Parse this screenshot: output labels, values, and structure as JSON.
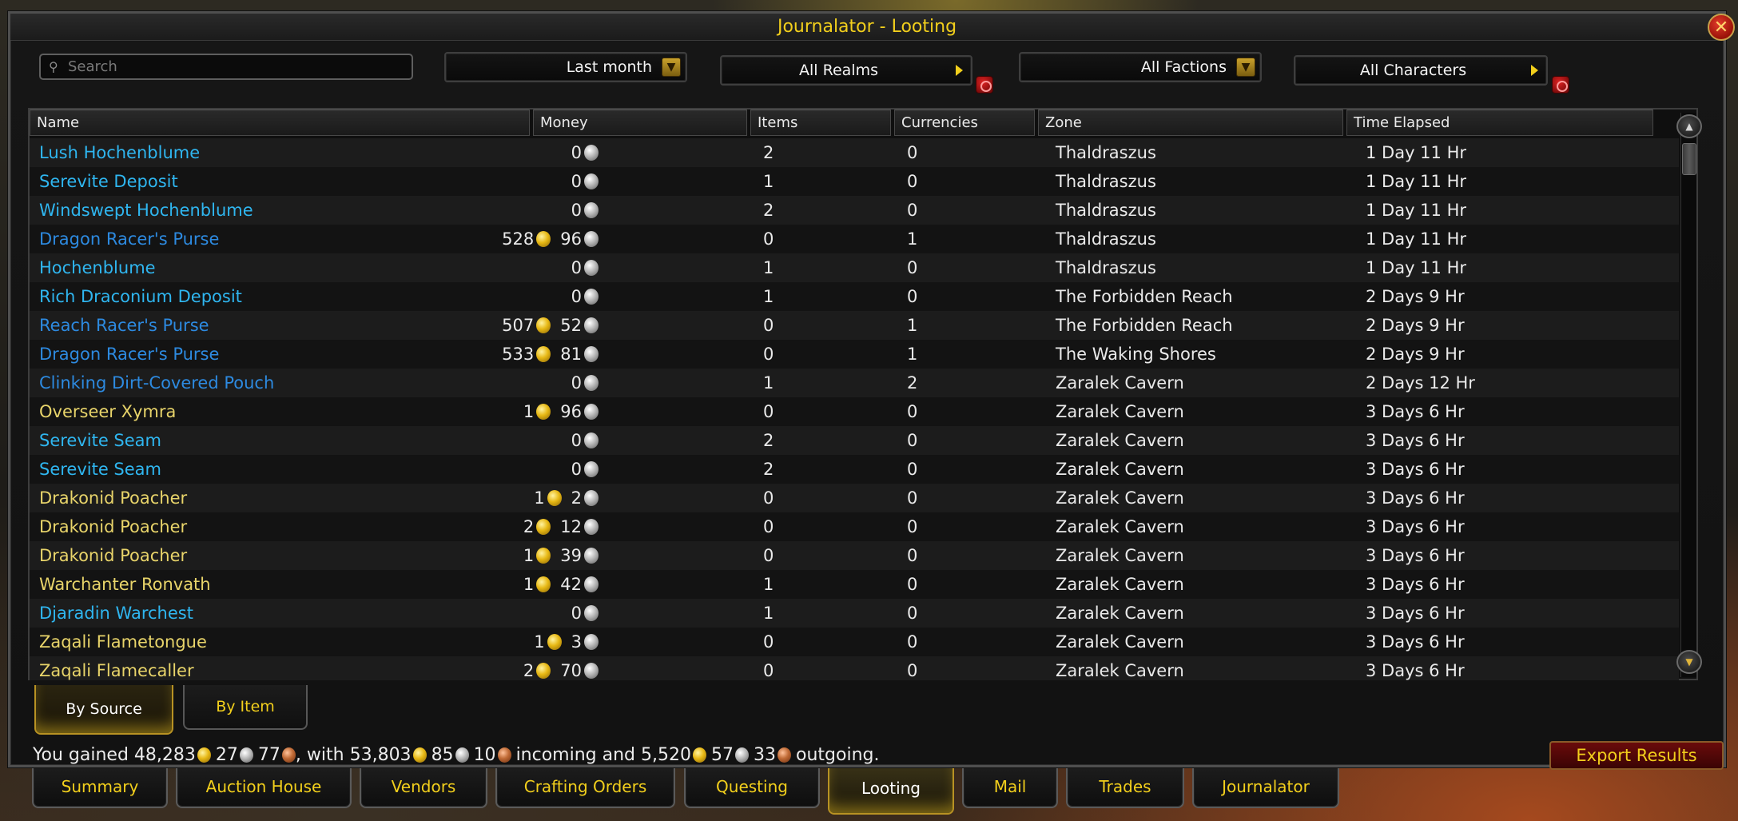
{
  "window": {
    "title": "Journalator - Looting",
    "close_icon": "close-icon"
  },
  "filters": {
    "search_placeholder": "Search",
    "time_range": "Last month",
    "realms": "All Realms",
    "factions": "All Factions",
    "characters": "All Characters"
  },
  "columns": [
    "Name",
    "Money",
    "Items",
    "Currencies",
    "Zone",
    "Time Elapsed"
  ],
  "colors": {
    "gold_text": "#f2cf1c",
    "name_gold": "#e8d46a",
    "name_cyan": "#2fb6f0",
    "name_blue": "#2d8ae0",
    "export_bg": "#6a0b0b"
  },
  "rows": [
    {
      "name": "Lush Hochenblume",
      "color": "cyan",
      "gold": null,
      "silver": "0",
      "items": "2",
      "currencies": "0",
      "zone": "Thaldraszus",
      "time": "1 Day 11 Hr"
    },
    {
      "name": "Serevite Deposit",
      "color": "cyan",
      "gold": null,
      "silver": "0",
      "items": "1",
      "currencies": "0",
      "zone": "Thaldraszus",
      "time": "1 Day 11 Hr"
    },
    {
      "name": "Windswept Hochenblume",
      "color": "cyan",
      "gold": null,
      "silver": "0",
      "items": "2",
      "currencies": "0",
      "zone": "Thaldraszus",
      "time": "1 Day 11 Hr"
    },
    {
      "name": "Dragon Racer's Purse",
      "color": "blue",
      "gold": "528",
      "silver": "96",
      "items": "0",
      "currencies": "1",
      "zone": "Thaldraszus",
      "time": "1 Day 11 Hr"
    },
    {
      "name": "Hochenblume",
      "color": "cyan",
      "gold": null,
      "silver": "0",
      "items": "1",
      "currencies": "0",
      "zone": "Thaldraszus",
      "time": "1 Day 11 Hr"
    },
    {
      "name": "Rich Draconium Deposit",
      "color": "cyan",
      "gold": null,
      "silver": "0",
      "items": "1",
      "currencies": "0",
      "zone": "The Forbidden Reach",
      "time": "2 Days 9 Hr"
    },
    {
      "name": "Reach Racer's Purse",
      "color": "blue",
      "gold": "507",
      "silver": "52",
      "items": "0",
      "currencies": "1",
      "zone": "The Forbidden Reach",
      "time": "2 Days 9 Hr"
    },
    {
      "name": "Dragon Racer's Purse",
      "color": "blue",
      "gold": "533",
      "silver": "81",
      "items": "0",
      "currencies": "1",
      "zone": "The Waking Shores",
      "time": "2 Days 9 Hr"
    },
    {
      "name": "Clinking Dirt-Covered Pouch",
      "color": "blue",
      "gold": null,
      "silver": "0",
      "items": "1",
      "currencies": "2",
      "zone": "Zaralek Cavern",
      "time": "2 Days 12 Hr"
    },
    {
      "name": "Overseer Xymra",
      "color": "gold",
      "gold": "1",
      "silver": "96",
      "items": "0",
      "currencies": "0",
      "zone": "Zaralek Cavern",
      "time": "3 Days 6 Hr"
    },
    {
      "name": "Serevite Seam",
      "color": "cyan",
      "gold": null,
      "silver": "0",
      "items": "2",
      "currencies": "0",
      "zone": "Zaralek Cavern",
      "time": "3 Days 6 Hr"
    },
    {
      "name": "Serevite Seam",
      "color": "cyan",
      "gold": null,
      "silver": "0",
      "items": "2",
      "currencies": "0",
      "zone": "Zaralek Cavern",
      "time": "3 Days 6 Hr"
    },
    {
      "name": "Drakonid Poacher",
      "color": "gold",
      "gold": "1",
      "silver": "2",
      "items": "0",
      "currencies": "0",
      "zone": "Zaralek Cavern",
      "time": "3 Days 6 Hr"
    },
    {
      "name": "Drakonid Poacher",
      "color": "gold",
      "gold": "2",
      "silver": "12",
      "items": "0",
      "currencies": "0",
      "zone": "Zaralek Cavern",
      "time": "3 Days 6 Hr"
    },
    {
      "name": "Drakonid Poacher",
      "color": "gold",
      "gold": "1",
      "silver": "39",
      "items": "0",
      "currencies": "0",
      "zone": "Zaralek Cavern",
      "time": "3 Days 6 Hr"
    },
    {
      "name": "Warchanter Ronvath",
      "color": "gold",
      "gold": "1",
      "silver": "42",
      "items": "1",
      "currencies": "0",
      "zone": "Zaralek Cavern",
      "time": "3 Days 6 Hr"
    },
    {
      "name": "Djaradin Warchest",
      "color": "cyan",
      "gold": null,
      "silver": "0",
      "items": "1",
      "currencies": "0",
      "zone": "Zaralek Cavern",
      "time": "3 Days 6 Hr"
    },
    {
      "name": "Zaqali Flametongue",
      "color": "gold",
      "gold": "1",
      "silver": "3",
      "items": "0",
      "currencies": "0",
      "zone": "Zaralek Cavern",
      "time": "3 Days 6 Hr"
    },
    {
      "name": "Zaqali Flamecaller",
      "color": "gold",
      "gold": "2",
      "silver": "70",
      "items": "0",
      "currencies": "0",
      "zone": "Zaralek Cavern",
      "time": "3 Days 6 Hr"
    }
  ],
  "view_tabs": {
    "by_source": "By Source",
    "by_item": "By Item",
    "active": "By Source"
  },
  "summary": {
    "prefix": "You gained",
    "gained_gold": "48,283",
    "gained_silver": "27",
    "gained_copper": "77",
    "mid1": ", with",
    "incoming_gold": "53,803",
    "incoming_silver": "85",
    "incoming_copper": "10",
    "mid2": "incoming and",
    "outgoing_gold": "5,520",
    "outgoing_silver": "57",
    "outgoing_copper": "33",
    "suffix": "outgoing."
  },
  "export_label": "Export Results",
  "bottom_tabs": [
    "Summary",
    "Auction House",
    "Vendors",
    "Crafting Orders",
    "Questing",
    "Looting",
    "Mail",
    "Trades",
    "Journalator"
  ],
  "active_bottom_tab": "Looting"
}
